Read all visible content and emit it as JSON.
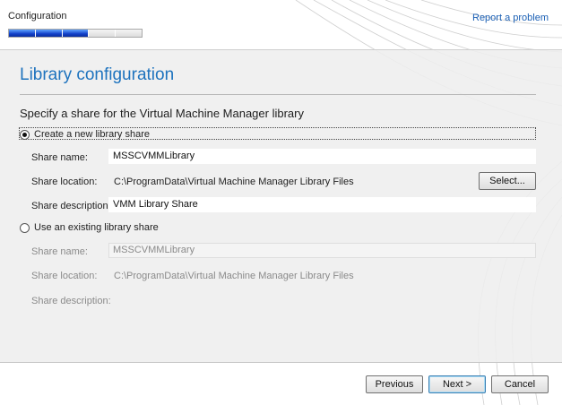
{
  "header": {
    "section_label": "Configuration",
    "report_link": "Report a problem",
    "progress": {
      "completed_steps": 3,
      "total_steps": 5
    }
  },
  "page": {
    "title": "Library configuration",
    "subtitle": "Specify a share for the Virtual Machine Manager library"
  },
  "new_share": {
    "option_label": "Create a new library share",
    "selected": true,
    "name_label": "Share name:",
    "name_value": "MSSCVMMLibrary",
    "location_label": "Share location:",
    "location_value": "C:\\ProgramData\\Virtual Machine Manager Library Files",
    "select_button": "Select...",
    "description_label": "Share description:",
    "description_value": "VMM Library Share"
  },
  "existing_share": {
    "option_label": "Use an existing library share",
    "selected": false,
    "name_label": "Share name:",
    "name_value": "MSSCVMMLibrary",
    "location_label": "Share location:",
    "location_value": "C:\\ProgramData\\Virtual Machine Manager Library Files",
    "description_label": "Share description:"
  },
  "footer": {
    "previous": "Previous",
    "next": "Next >",
    "cancel": "Cancel"
  },
  "colors": {
    "title_blue": "#1e73be",
    "link_blue": "#1a5fb4",
    "progress_blue": "#1240c8"
  }
}
